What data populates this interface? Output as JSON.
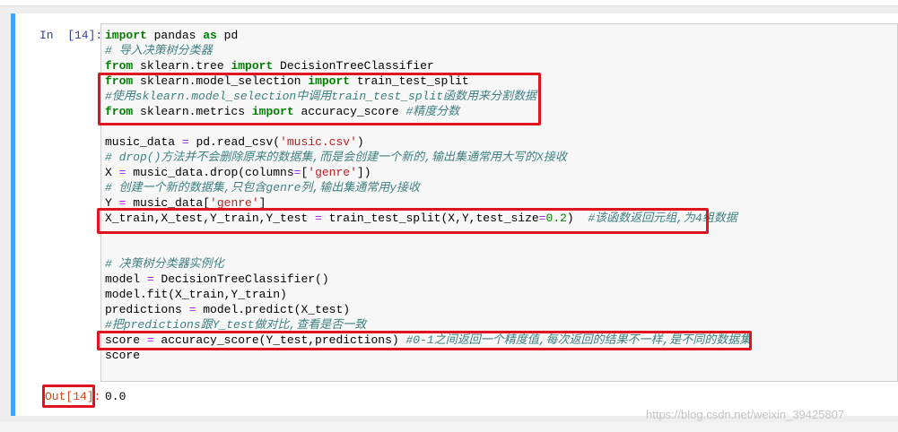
{
  "cell": {
    "in_prompt": "In  [14]:",
    "out_prompt": "Out[14]:",
    "output": "0.0",
    "code_lines": [
      [
        {
          "t": "import",
          "c": "kw"
        },
        {
          "t": " pandas "
        },
        {
          "t": "as",
          "c": "kw"
        },
        {
          "t": " pd"
        }
      ],
      [
        {
          "t": "# 导入决策树分类器",
          "c": "cm"
        }
      ],
      [
        {
          "t": "from",
          "c": "kw"
        },
        {
          "t": " sklearn.tree "
        },
        {
          "t": "import",
          "c": "kw"
        },
        {
          "t": " DecisionTreeClassifier"
        }
      ],
      [
        {
          "t": "from",
          "c": "kw"
        },
        {
          "t": " sklearn.model_selection "
        },
        {
          "t": "import",
          "c": "kw"
        },
        {
          "t": " train_test_split"
        }
      ],
      [
        {
          "t": "#使用sklearn.model_selection中调用train_test_split函数用来分割数据",
          "c": "cm"
        }
      ],
      [
        {
          "t": "from",
          "c": "kw"
        },
        {
          "t": " sklearn.metrics "
        },
        {
          "t": "import",
          "c": "kw"
        },
        {
          "t": " accuracy_score "
        },
        {
          "t": "#精度分数",
          "c": "cm"
        }
      ],
      [],
      [
        {
          "t": "music_data "
        },
        {
          "t": "=",
          "c": "op"
        },
        {
          "t": " pd.read_csv("
        },
        {
          "t": "'music.csv'",
          "c": "str"
        },
        {
          "t": ")"
        }
      ],
      [
        {
          "t": "# drop()方法并不会删除原来的数据集,而是会创建一个新的,输出集通常用大写的X接收",
          "c": "cm"
        }
      ],
      [
        {
          "t": "X "
        },
        {
          "t": "=",
          "c": "op"
        },
        {
          "t": " music_data.drop(columns"
        },
        {
          "t": "=",
          "c": "op"
        },
        {
          "t": "["
        },
        {
          "t": "'genre'",
          "c": "str"
        },
        {
          "t": "])"
        }
      ],
      [
        {
          "t": "# 创建一个新的数据集,只包含genre列,输出集通常用y接收",
          "c": "cm"
        }
      ],
      [
        {
          "t": "Y "
        },
        {
          "t": "=",
          "c": "op"
        },
        {
          "t": " music_data["
        },
        {
          "t": "'genre'",
          "c": "str"
        },
        {
          "t": "]"
        }
      ],
      [
        {
          "t": "X_train,X_test,Y_train,Y_test "
        },
        {
          "t": "=",
          "c": "op"
        },
        {
          "t": " train_test_split(X,Y,test_size"
        },
        {
          "t": "=",
          "c": "op"
        },
        {
          "t": "0.2",
          "c": "num"
        },
        {
          "t": ")  "
        },
        {
          "t": "#该函数返回元组,为4组数据",
          "c": "cm"
        }
      ],
      [],
      [],
      [
        {
          "t": "# 决策树分类器实例化",
          "c": "cm"
        }
      ],
      [
        {
          "t": "model "
        },
        {
          "t": "=",
          "c": "op"
        },
        {
          "t": " DecisionTreeClassifier()"
        }
      ],
      [
        {
          "t": "model.fit(X_train,Y_train)"
        }
      ],
      [
        {
          "t": "predictions "
        },
        {
          "t": "=",
          "c": "op"
        },
        {
          "t": " model.predict(X_test)"
        }
      ],
      [
        {
          "t": "#把predictions跟Y_test做对比,查看是否一致",
          "c": "cm"
        }
      ],
      [
        {
          "t": "score "
        },
        {
          "t": "=",
          "c": "op"
        },
        {
          "t": " accuracy_score(Y_test,predictions) "
        },
        {
          "t": "#0-1之间返回一个精度值,每次返回的结果不一样,是不同的数据集",
          "c": "cm"
        }
      ],
      [
        {
          "t": "score"
        }
      ]
    ]
  },
  "watermark": "https://blog.csdn.net/weixin_39425807"
}
